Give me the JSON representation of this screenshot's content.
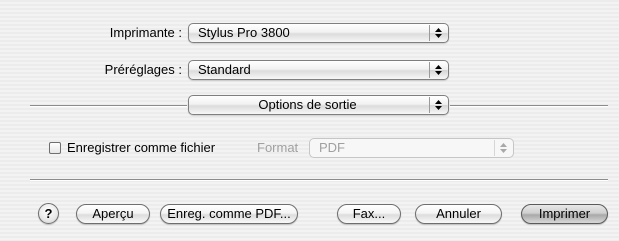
{
  "printer": {
    "label": "Imprimante :",
    "value": "Stylus Pro 3800"
  },
  "presets": {
    "label": "Préréglages :",
    "value": "Standard"
  },
  "section": {
    "value": "Options de sortie"
  },
  "save_as_file": {
    "checkbox_label": "Enregistrer comme fichier",
    "checked": false,
    "format_label": "Format",
    "format_value": "PDF"
  },
  "buttons": {
    "help": "?",
    "preview": "Aperçu",
    "save_pdf": "Enreg. comme PDF...",
    "fax": "Fax...",
    "cancel": "Annuler",
    "print": "Imprimer"
  },
  "icons": [
    "popup-arrows-icon",
    "help-icon"
  ]
}
